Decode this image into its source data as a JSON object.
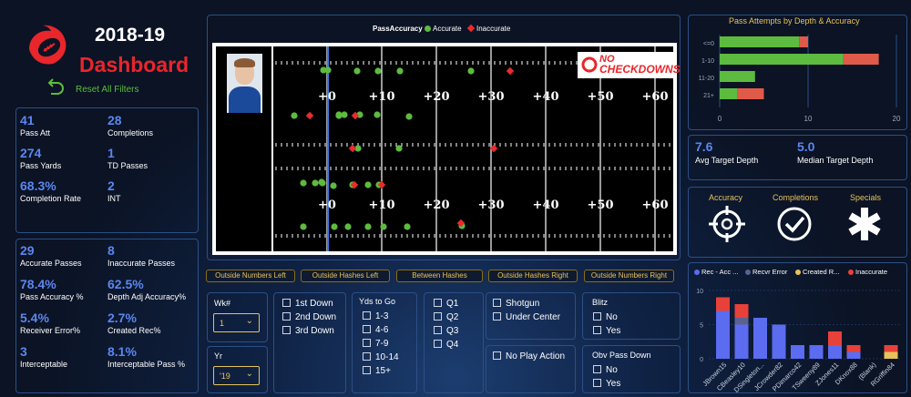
{
  "header": {
    "year": "2018-19",
    "title": "Dashboard",
    "reset_label": "Reset All Filters"
  },
  "colors": {
    "accent": "#5b86f0",
    "brand_red": "#e8262b",
    "accurate": "#5dbb3f",
    "inaccurate": "#e82c2c",
    "bar_blue": "#5b6cf0",
    "gold": "#e8c25a"
  },
  "stats1": [
    {
      "value": "41",
      "label": "Pass Att"
    },
    {
      "value": "28",
      "label": "Completions"
    },
    {
      "value": "274",
      "label": "Pass Yards"
    },
    {
      "value": "1",
      "label": "TD Passes"
    },
    {
      "value": "68.3%",
      "label": "Completion Rate"
    },
    {
      "value": "2",
      "label": "INT"
    }
  ],
  "stats2": [
    {
      "value": "29",
      "label": "Accurate Passes"
    },
    {
      "value": "8",
      "label": "Inaccurate Passes"
    },
    {
      "value": "78.4%",
      "label": "Pass Accuracy %"
    },
    {
      "value": "62.5%",
      "label": "Depth Adj Accuracy%"
    },
    {
      "value": "5.4%",
      "label": "Receiver Error%"
    },
    {
      "value": "2.7%",
      "label": "Created Rec%"
    },
    {
      "value": "3",
      "label": "Interceptable"
    },
    {
      "value": "8.1%",
      "label": "Interceptable Pass %"
    }
  ],
  "field": {
    "legend_title": "PassAccuracy",
    "legend_accurate": "Accurate",
    "legend_inaccurate": "Inaccurate",
    "logo_top": "NO",
    "logo_bottom": "CHECKDOWNS",
    "yard_labels": [
      "+0",
      "+10",
      "+20",
      "+30",
      "+40",
      "+50",
      "+60"
    ]
  },
  "zones": [
    "Outside Numbers Left",
    "Outside Hashes Left",
    "Between Hashes",
    "Outside Hashes Right",
    "Outside Numbers Right"
  ],
  "chart_data": [
    {
      "type": "bar",
      "title": "Pass Attempts by Depth & Accuracy",
      "categories": [
        "<=0",
        "1-10",
        "11-20",
        "21+"
      ],
      "series": [
        {
          "name": "Accurate",
          "values": [
            9,
            14,
            4,
            2
          ]
        },
        {
          "name": "Inaccurate",
          "values": [
            1,
            4,
            0,
            3
          ]
        }
      ],
      "xlim": [
        0,
        20
      ],
      "ticks": [
        "0",
        "10",
        "20"
      ]
    },
    {
      "type": "bar",
      "legend": [
        "Rec - Acc ...",
        "Recvr Error",
        "Created R...",
        "Inaccurate"
      ],
      "categories": [
        "JBrown15",
        "CBeasley10",
        "DSingleton...",
        "JCrowder82",
        "PDimarco42",
        "TSweeny89",
        "ZJones11",
        "DKnox88",
        "(Blank)",
        "RGriffin84"
      ],
      "series": [
        {
          "name": "Rec - Acc ...",
          "values": [
            7,
            5,
            6,
            5,
            2,
            2,
            2,
            1,
            0,
            0
          ]
        },
        {
          "name": "Recvr Error",
          "values": [
            0,
            1,
            0,
            0,
            0,
            0,
            0,
            0,
            0,
            0
          ]
        },
        {
          "name": "Created R...",
          "values": [
            0,
            0,
            0,
            0,
            0,
            0,
            0,
            0,
            0,
            1
          ]
        },
        {
          "name": "Inaccurate",
          "values": [
            2,
            2,
            0,
            0,
            0,
            0,
            2,
            1,
            0,
            1
          ]
        }
      ],
      "ylim": [
        0,
        10
      ],
      "ticks": [
        "0",
        "5",
        "10"
      ]
    }
  ],
  "depth": {
    "avg_value": "7.6",
    "avg_label": "Avg Target Depth",
    "median_value": "5.0",
    "median_label": "Median Target Depth"
  },
  "icons": {
    "accuracy": "Accuracy",
    "completions": "Completions",
    "specials": "Specials"
  },
  "slicers": {
    "wk_title": "Wk#",
    "wk_value": "1",
    "yr_title": "Yr",
    "yr_value": "'19",
    "downs": [
      "1st Down",
      "2nd Down",
      "3rd Down"
    ],
    "yds_title": "Yds to Go",
    "yds": [
      "1-3",
      "4-6",
      "7-9",
      "10-14",
      "15+"
    ],
    "quarters": [
      "Q1",
      "Q2",
      "Q3",
      "Q4"
    ],
    "formation": [
      "Shotgun",
      "Under Center"
    ],
    "play_action": "No Play Action",
    "blitz_title": "Blitz",
    "blitz": [
      "No",
      "Yes"
    ],
    "obv_title": "Obv Pass Down",
    "obv": [
      "No",
      "Yes"
    ]
  }
}
